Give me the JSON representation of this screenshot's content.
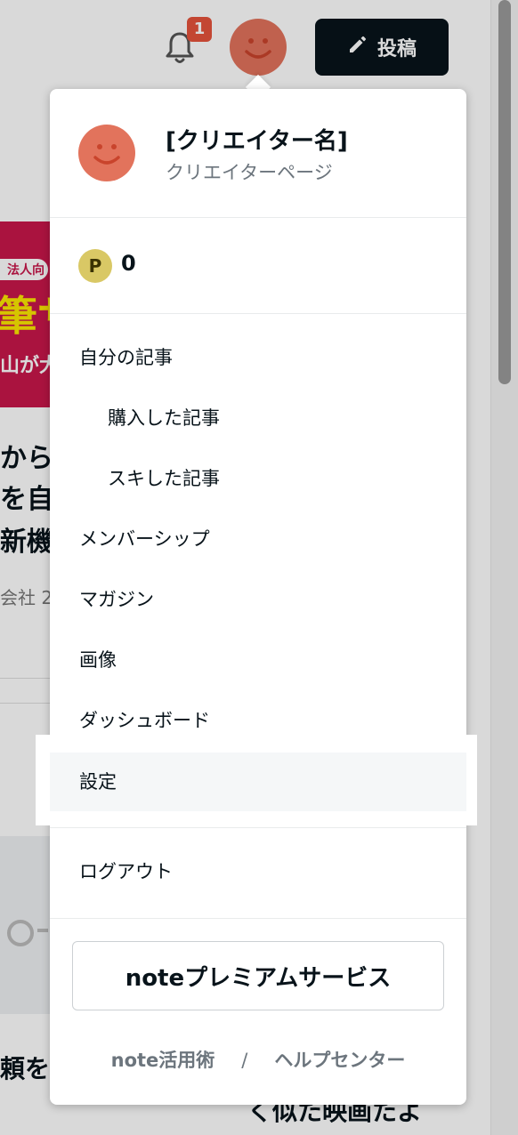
{
  "header": {
    "notification_count": "1",
    "post_label": "投稿"
  },
  "background": {
    "banner_pill": "法人向",
    "banner_big": "筆サ",
    "banner_small": "山が大",
    "title_lines": [
      "から",
      "を自",
      "新機"
    ],
    "meta": "会社 2",
    "bottom_left": "頼を",
    "bottom_right": "く似た映画たよ"
  },
  "menu": {
    "profile": {
      "name": "[クリエイター名]",
      "subtitle": "クリエイターページ"
    },
    "points": {
      "icon_letter": "P",
      "value": "0"
    },
    "items": [
      {
        "label": "自分の記事"
      },
      {
        "label": "購入した記事"
      },
      {
        "label": "スキした記事"
      },
      {
        "label": "メンバーシップ"
      },
      {
        "label": "マガジン"
      },
      {
        "label": "画像"
      },
      {
        "label": "ダッシュボード"
      },
      {
        "label": "設定"
      },
      {
        "label": "ログアウト"
      }
    ],
    "premium_label": "noteプレミアムサービス",
    "footer": {
      "link1": "note活用術",
      "separator": "/",
      "link2": "ヘルプセンター"
    }
  },
  "colors": {
    "avatar": "#e2735c",
    "badge": "#e5533b",
    "post_button": "#08131a",
    "points_coin": "#d9c865"
  }
}
